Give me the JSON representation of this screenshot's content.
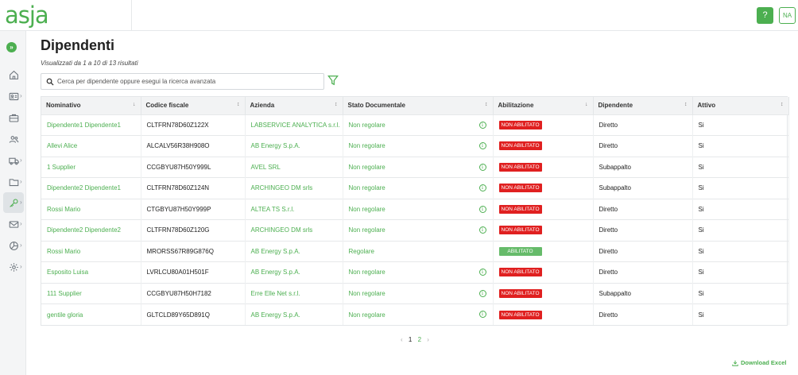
{
  "header": {
    "logo": "asja",
    "help_label": "?",
    "user_initials": "NA"
  },
  "page": {
    "title": "Dipendenti",
    "results_text": "Visualizzati da 1 a 10 di 13 risultati",
    "search_placeholder": "Cerca per dipendente oppure esegui la ricerca avanzata"
  },
  "table": {
    "columns": [
      "Nominativo",
      "Codice fiscale",
      "Azienda",
      "Stato Documentale",
      "Abilitazione",
      "Dipendente",
      "Attivo"
    ],
    "rows": [
      {
        "nominativo": "Dipendente1 Dipendente1",
        "cf": "CLTFRN78D60Z122X",
        "azienda": "LABSERVICE ANALYTICA s.r.l.",
        "stato": "Non regolare",
        "info": true,
        "abilitazione": "NON ABILITATO",
        "dipendente": "Diretto",
        "attivo": "Si"
      },
      {
        "nominativo": "Allevi Alice",
        "cf": "ALCALV56R38H908O",
        "azienda": "AB Energy S.p.A.",
        "stato": "Non regolare",
        "info": true,
        "abilitazione": "NON ABILITATO",
        "dipendente": "Diretto",
        "attivo": "Si"
      },
      {
        "nominativo": "1 Supplier",
        "cf": "CCGBYU87H50Y999L",
        "azienda": "AVEL SRL",
        "stato": "Non regolare",
        "info": true,
        "abilitazione": "NON ABILITATO",
        "dipendente": "Subappalto",
        "attivo": "Si"
      },
      {
        "nominativo": "Dipendente2 Dipendente1",
        "cf": "CLTFRN78D60Z124N",
        "azienda": "ARCHINGEO DM srls",
        "stato": "Non regolare",
        "info": true,
        "abilitazione": "NON ABILITATO",
        "dipendente": "Subappalto",
        "attivo": "Si"
      },
      {
        "nominativo": "Rossi Mario",
        "cf": "CTGBYU87H50Y999P",
        "azienda": "ALTEA TS S.r.l.",
        "stato": "Non regolare",
        "info": true,
        "abilitazione": "NON ABILITATO",
        "dipendente": "Diretto",
        "attivo": "Si"
      },
      {
        "nominativo": "Dipendente2 Dipendente2",
        "cf": "CLTFRN78D60Z120G",
        "azienda": "ARCHINGEO DM srls",
        "stato": "Non regolare",
        "info": true,
        "abilitazione": "NON ABILITATO",
        "dipendente": "Diretto",
        "attivo": "Si"
      },
      {
        "nominativo": "Rossi Mario",
        "cf": "MRORSS67R89G876Q",
        "azienda": "AB Energy S.p.A.",
        "stato": "Regolare",
        "info": false,
        "abilitazione": "ABILITATO",
        "dipendente": "Diretto",
        "attivo": "Si"
      },
      {
        "nominativo": "Esposito Luisa",
        "cf": "LVRLCU80A01H501F",
        "azienda": "AB Energy S.p.A.",
        "stato": "Non regolare",
        "info": true,
        "abilitazione": "NON ABILITATO",
        "dipendente": "Diretto",
        "attivo": "Si"
      },
      {
        "nominativo": "111 Supplier",
        "cf": "CCGBYU87H50H7182",
        "azienda": "Erre Elle Net s.r.l.",
        "stato": "Non regolare",
        "info": true,
        "abilitazione": "NON ABILITATO",
        "dipendente": "Subappalto",
        "attivo": "Si"
      },
      {
        "nominativo": "gentile gloria",
        "cf": "GLTCLD89Y65D891Q",
        "azienda": "AB Energy S.p.A.",
        "stato": "Non regolare",
        "info": true,
        "abilitazione": "NON ABILITATO",
        "dipendente": "Diretto",
        "attivo": "Si"
      }
    ]
  },
  "pagination": {
    "prev": "‹",
    "pages": [
      "1",
      "2"
    ],
    "current": "1",
    "next": "›"
  },
  "download_label": "Download Excel",
  "colors": {
    "accent": "#4caf50",
    "danger": "#e02020",
    "success_badge": "#66bb6a"
  },
  "sidebar": {
    "items": [
      {
        "icon": "home-icon",
        "chevron": false
      },
      {
        "icon": "id-card-icon",
        "chevron": true
      },
      {
        "icon": "briefcase-icon",
        "chevron": false
      },
      {
        "icon": "users-icon",
        "chevron": false
      },
      {
        "icon": "truck-icon",
        "chevron": true
      },
      {
        "icon": "folder-icon",
        "chevron": true
      },
      {
        "icon": "key-icon",
        "chevron": true,
        "active": true
      },
      {
        "icon": "mail-icon",
        "chevron": true
      },
      {
        "icon": "pie-chart-icon",
        "chevron": true
      },
      {
        "icon": "gear-icon",
        "chevron": true
      }
    ]
  }
}
